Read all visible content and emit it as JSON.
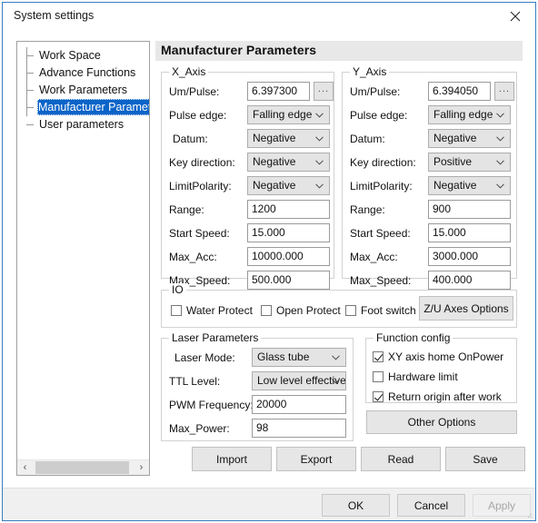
{
  "window": {
    "title": "System settings",
    "close_icon": "close-icon"
  },
  "sidebar": {
    "items": [
      {
        "label": "Work Space",
        "selected": false
      },
      {
        "label": "Advance Functions",
        "selected": false
      },
      {
        "label": "Work Parameters",
        "selected": false
      },
      {
        "label": "Manufacturer Paramet",
        "selected": true
      },
      {
        "label": "User parameters",
        "selected": false
      }
    ],
    "scrollbar": {
      "left_arrow": "‹",
      "right_arrow": "›"
    }
  },
  "main": {
    "header_title": "Manufacturer Parameters",
    "x_axis": {
      "title": "X_Axis",
      "labels": {
        "um_pulse": "Um/Pulse:",
        "pulse_edge": "Pulse edge:",
        "datum": "Datum:",
        "key_direction": "Key direction:",
        "limit_polarity": "LimitPolarity:",
        "range": "Range:",
        "start_speed": "Start Speed:",
        "max_acc": "Max_Acc:",
        "max_speed": "Max_Speed:"
      },
      "values": {
        "um_pulse": "6.397300",
        "pulse_edge": "Falling edge",
        "datum": "Negative",
        "key_direction": "Negative",
        "limit_polarity": "Negative",
        "range": "1200",
        "start_speed": "15.000",
        "max_acc": "10000.000",
        "max_speed": "500.000"
      },
      "browse_label": "..."
    },
    "y_axis": {
      "title": "Y_Axis",
      "labels": {
        "um_pulse": "Um/Pulse:",
        "pulse_edge": "Pulse edge:",
        "datum": "Datum:",
        "key_direction": "Key direction:",
        "limit_polarity": "LimitPolarity:",
        "range": "Range:",
        "start_speed": "Start Speed:",
        "max_acc": "Max_Acc:",
        "max_speed": "Max_Speed:"
      },
      "values": {
        "um_pulse": "6.394050",
        "pulse_edge": "Falling edge",
        "datum": "Negative",
        "key_direction": "Positive",
        "limit_polarity": "Negative",
        "range": "900",
        "start_speed": "15.000",
        "max_acc": "3000.000",
        "max_speed": "400.000"
      },
      "browse_label": "..."
    },
    "io": {
      "title": "IO",
      "checkboxes": [
        {
          "label": "Water Protect",
          "checked": false
        },
        {
          "label": "Open Protect",
          "checked": false
        },
        {
          "label": "Foot switch",
          "checked": false
        }
      ],
      "zu_button": "Z/U Axes Options"
    },
    "laser_parameters": {
      "title": "Laser Parameters",
      "labels": {
        "laser_mode": "Laser Mode:",
        "ttl_level": "TTL Level:",
        "pwm_frequency": "PWM Frequency:",
        "max_power": "Max_Power:"
      },
      "values": {
        "laser_mode": "Glass tube",
        "ttl_level": "Low level effective",
        "pwm_frequency": "20000",
        "max_power": "98"
      }
    },
    "function_config": {
      "title": "Function config",
      "checkboxes": [
        {
          "label": "XY axis home OnPower",
          "checked": true
        },
        {
          "label": "Hardware limit",
          "checked": false
        },
        {
          "label": "Return origin after work",
          "checked": true
        }
      ],
      "other_options_button": "Other Options"
    },
    "action_buttons": [
      {
        "label": "Import"
      },
      {
        "label": "Export"
      },
      {
        "label": "Read"
      },
      {
        "label": "Save"
      }
    ]
  },
  "footer": {
    "ok": "OK",
    "cancel": "Cancel",
    "apply": "Apply"
  },
  "colors": {
    "selection": "#0a64c8",
    "focus_border": "#1a7fd4",
    "window_border": "#3a7cbf",
    "dialog_bg": "#f0f0f0"
  }
}
